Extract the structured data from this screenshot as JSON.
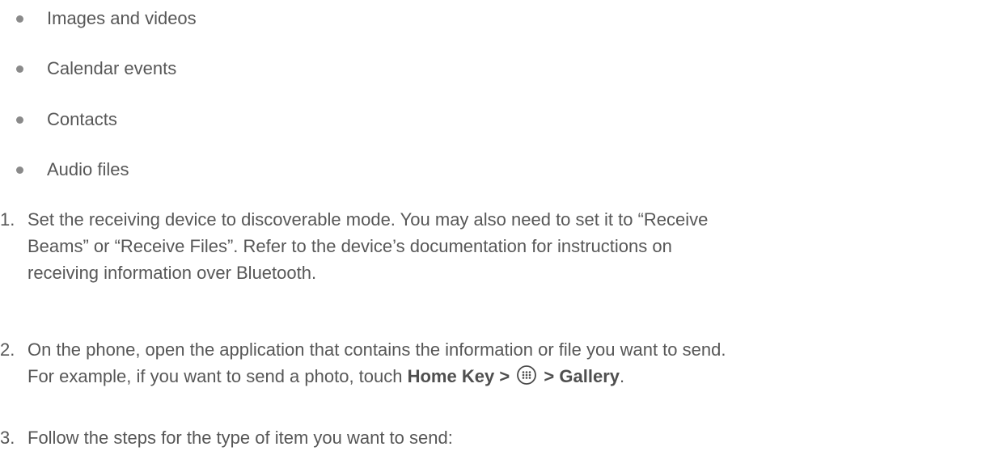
{
  "bullets": [
    {
      "label": "Images and videos"
    },
    {
      "label": "Calendar events"
    },
    {
      "label": "Contacts"
    },
    {
      "label": "Audio files"
    }
  ],
  "steps": [
    {
      "number": "1.",
      "lines": [
        "Set the receiving device to discoverable mode. You may also need to set it to “Receive",
        "Beams” or “Receive Files”. Refer to the device’s documentation for instructions on",
        "receiving information over Bluetooth."
      ]
    },
    {
      "number": "2.",
      "line1": "On the phone, open the application that contains the information or file you want to send.",
      "line2_prefix": "For example, if you want to send a photo, touch ",
      "line2_bold1": "Home Key >",
      "line2_icon": "apps-grid-icon",
      "line2_bold2": "> Gallery",
      "line2_suffix": "."
    },
    {
      "number": "3.",
      "lines": [
        "Follow the steps for the type of item you want to send:"
      ]
    }
  ]
}
